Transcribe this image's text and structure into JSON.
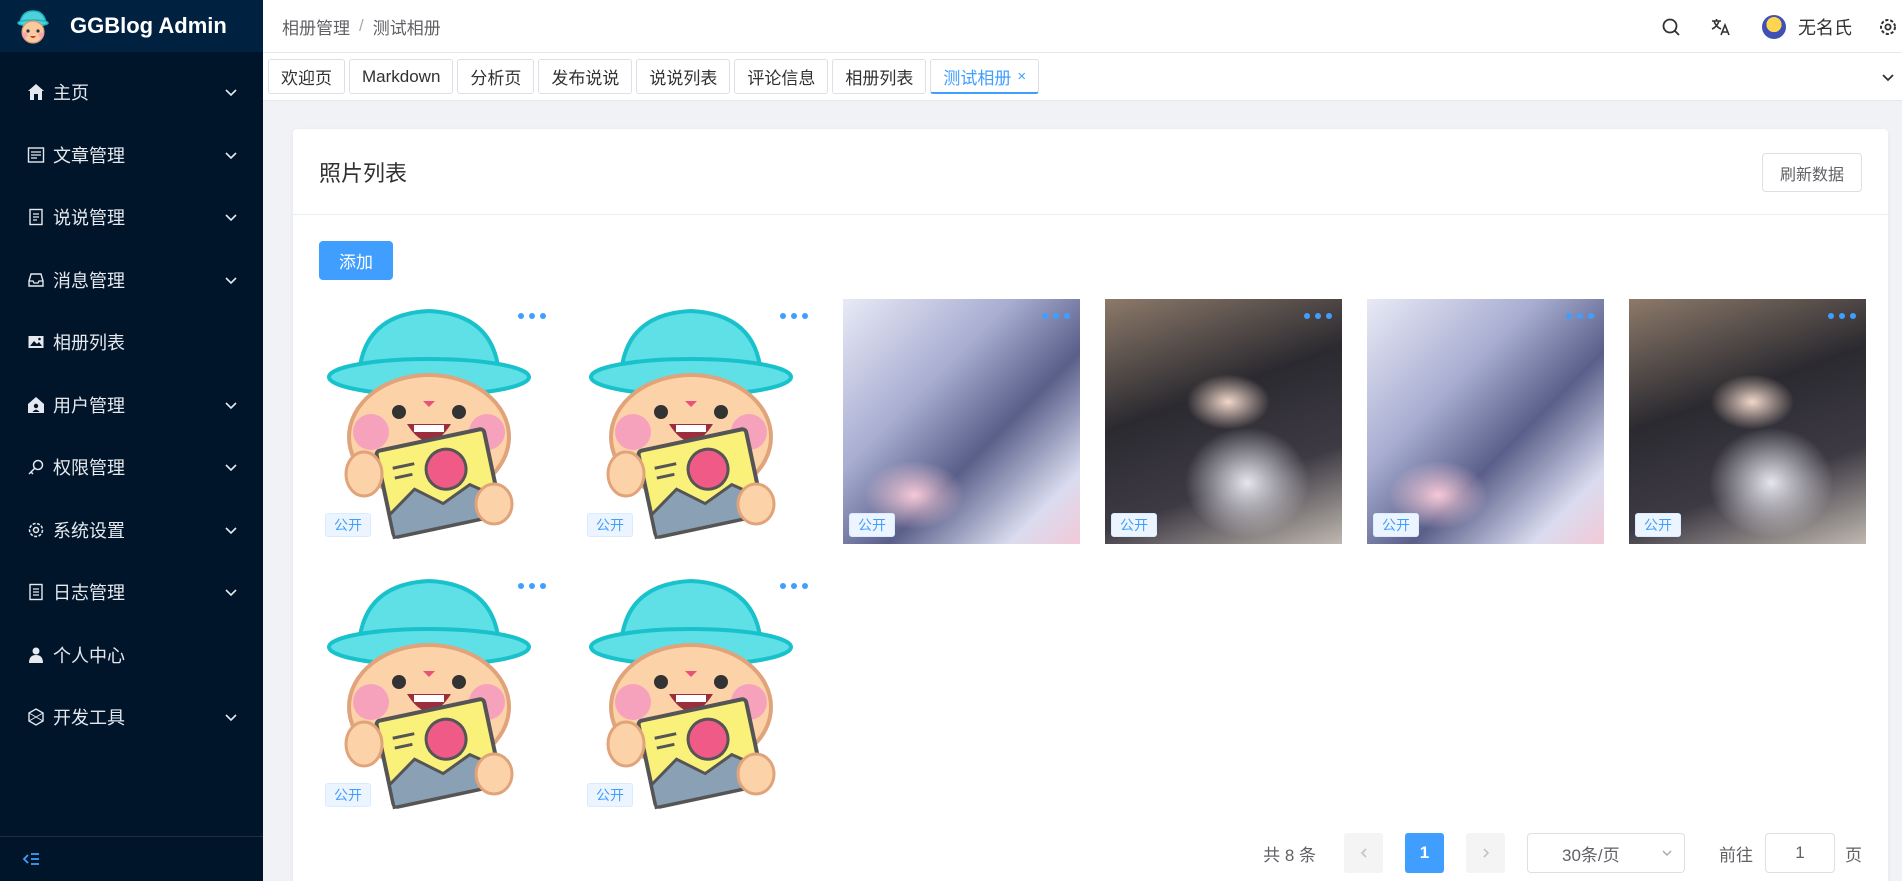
{
  "app": {
    "title": "GGBlog Admin"
  },
  "sidebar": {
    "items": [
      {
        "label": "主页",
        "icon": "home-icon",
        "has_arrow": true
      },
      {
        "label": "文章管理",
        "icon": "article-icon",
        "has_arrow": true
      },
      {
        "label": "说说管理",
        "icon": "note-icon",
        "has_arrow": true
      },
      {
        "label": "消息管理",
        "icon": "inbox-icon",
        "has_arrow": true
      },
      {
        "label": "相册列表",
        "icon": "picture-icon",
        "has_arrow": false
      },
      {
        "label": "用户管理",
        "icon": "user-home-icon",
        "has_arrow": true
      },
      {
        "label": "权限管理",
        "icon": "key-icon",
        "has_arrow": true
      },
      {
        "label": "系统设置",
        "icon": "gear-icon",
        "has_arrow": true
      },
      {
        "label": "日志管理",
        "icon": "document-icon",
        "has_arrow": true
      },
      {
        "label": "个人中心",
        "icon": "user-icon",
        "has_arrow": false
      },
      {
        "label": "开发工具",
        "icon": "tools-icon",
        "has_arrow": true
      }
    ]
  },
  "breadcrumb": {
    "parent": "相册管理",
    "separator": "/",
    "current": "测试相册"
  },
  "header": {
    "user_name": "无名氏"
  },
  "tabs": [
    {
      "label": "欢迎页",
      "active": false
    },
    {
      "label": "Markdown",
      "active": false
    },
    {
      "label": "分析页",
      "active": false
    },
    {
      "label": "发布说说",
      "active": false
    },
    {
      "label": "说说列表",
      "active": false
    },
    {
      "label": "评论信息",
      "active": false
    },
    {
      "label": "相册列表",
      "active": false
    },
    {
      "label": "测试相册",
      "active": true,
      "close": "×"
    }
  ],
  "card": {
    "title": "照片列表",
    "refresh_label": "刷新数据",
    "add_label": "添加"
  },
  "photos": [
    {
      "image": "mascot",
      "badge": "公开"
    },
    {
      "image": "mascot",
      "badge": "公开"
    },
    {
      "image": "mecha-art",
      "badge": "公开"
    },
    {
      "image": "girl-portrait",
      "badge": "公开"
    },
    {
      "image": "mecha-art",
      "badge": "公开"
    },
    {
      "image": "girl-portrait",
      "badge": "公开"
    },
    {
      "image": "mascot",
      "badge": "公开"
    },
    {
      "image": "mascot",
      "badge": "公开"
    }
  ],
  "pagination": {
    "total_text": "共 8 条",
    "current_page": "1",
    "page_size": "30条/页",
    "goto_prefix": "前往",
    "goto_value": "1",
    "goto_suffix": "页"
  },
  "colors": {
    "primary": "#409eff",
    "sidebar_bg": "#001529"
  }
}
